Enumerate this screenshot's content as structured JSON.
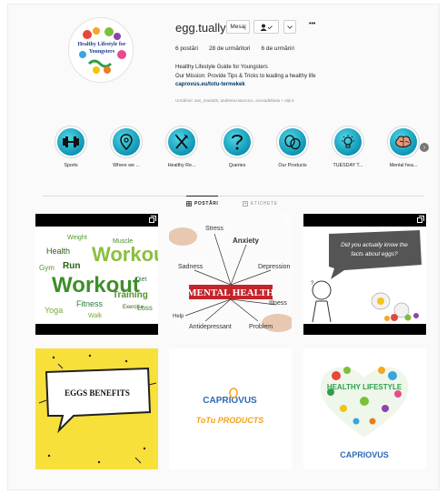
{
  "profile": {
    "username": "egg.tually",
    "message_button": "Mesaj",
    "more_icon": "•••",
    "stats": {
      "posts": "6 postări",
      "followers": "28 de urmăritori",
      "following": "6 de urmăriri"
    },
    "bio_line1": "Healthy Lifestyle Guide for Youngsters",
    "bio_line2": "Our Mission: Provide Tips & Tricks to leading a healthy life",
    "link": "caprovus.eu/totu-termekek",
    "followed_by": "Urmăriori: ami_maria25, andreea.marocico, onceadefania + alții 6",
    "avatar_text_line1": "Healthy Lifestyle for",
    "avatar_text_line2": "Youngsters"
  },
  "highlights": [
    {
      "label": "Sports",
      "icon": "dumbbell-icon"
    },
    {
      "label": "Where we ...",
      "icon": "location-pin-icon"
    },
    {
      "label": "Healthy Re...",
      "icon": "fork-knife-icon"
    },
    {
      "label": "Queries",
      "icon": "question-mark-icon"
    },
    {
      "label": "Our Products",
      "icon": "eggs-icon"
    },
    {
      "label": "TUESDAY T...",
      "icon": "lightbulb-icon"
    },
    {
      "label": "Mental hea...",
      "icon": "brain-icon"
    }
  ],
  "tabs": {
    "posts": "POSTĂRI",
    "tagged": "ETICHETE"
  },
  "posts": {
    "workout_word": "Workout",
    "workout_words": [
      "Health",
      "Gym",
      "Fitness",
      "Training",
      "Loss",
      "Yoga",
      "Muscle",
      "Exercise",
      "Weight",
      "Run",
      "Walk",
      "Diet"
    ],
    "mental_health_title": "MENTAL HEALTH",
    "mental_health_words": [
      "Stress",
      "Anxiety",
      "Depression",
      "Sadness",
      "Illness",
      "Problem",
      "Antidepressant",
      "Help"
    ],
    "egg_question": "Did you actually know the facts about eggs?",
    "eggs_benefits": "EGGS BENEFITS",
    "caprovus_logo": "CAPRIOVUS",
    "totu_products": "ToTu PRODUCTS",
    "heart_text": "HEALTHY LIFESTYLE"
  },
  "colors": {
    "highlight_teal": "#0e95b4",
    "link_blue": "#00376b",
    "eggs_yellow": "#f7e03a",
    "caprovus_blue": "#2d6bb3",
    "caprovus_orange": "#f2a21b"
  }
}
